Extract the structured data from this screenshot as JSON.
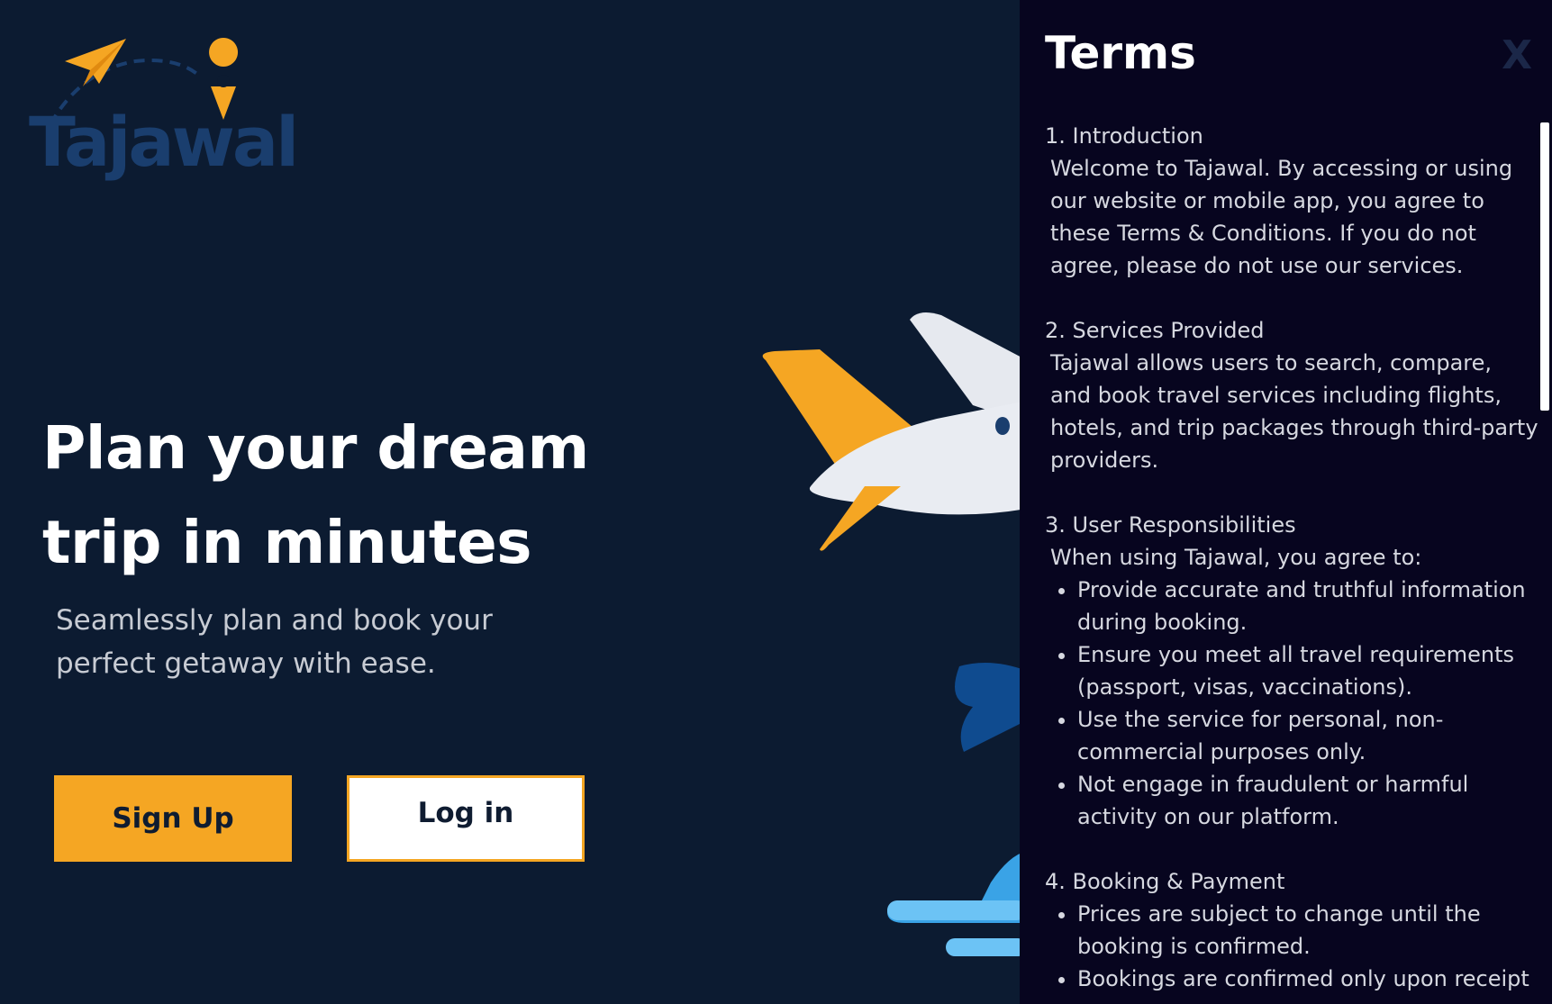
{
  "brand": {
    "name": "Tajawal",
    "primary_color": "#f5a623",
    "text_color": "#1a3e6e"
  },
  "hero": {
    "title_line1": "Plan your dream",
    "title_line2": "trip in minutes",
    "subtitle_line1": "Seamlessly plan and book your",
    "subtitle_line2": "perfect getaway with ease."
  },
  "actions": {
    "signup_label": "Sign Up",
    "login_label": "Log in"
  },
  "terms": {
    "title": "Terms",
    "close_label": "X",
    "sections": {
      "intro": {
        "heading": "1. Introduction",
        "text": "Welcome to Tajawal. By accessing or using our website or mobile app, you agree to these Terms & Conditions. If you do not agree, please do not use our services."
      },
      "services": {
        "heading": "2. Services Provided",
        "text": "Tajawal allows users to search, compare, and book travel services including flights, hotels, and trip packages through third-party providers."
      },
      "responsibilities": {
        "heading": "3. User Responsibilities",
        "text": "When using Tajawal, you agree to:",
        "items": [
          "Provide accurate and truthful information during booking.",
          "Ensure you meet all travel requirements (passport, visas, vaccinations).",
          "Use the service for personal, non-commercial purposes only.",
          "Not engage in fraudulent or harmful activity on our platform."
        ]
      },
      "booking": {
        "heading": "4. Booking & Payment",
        "items": [
          "Prices are subject to change until the booking is confirmed.",
          "Bookings are confirmed only upon receipt"
        ]
      }
    }
  }
}
